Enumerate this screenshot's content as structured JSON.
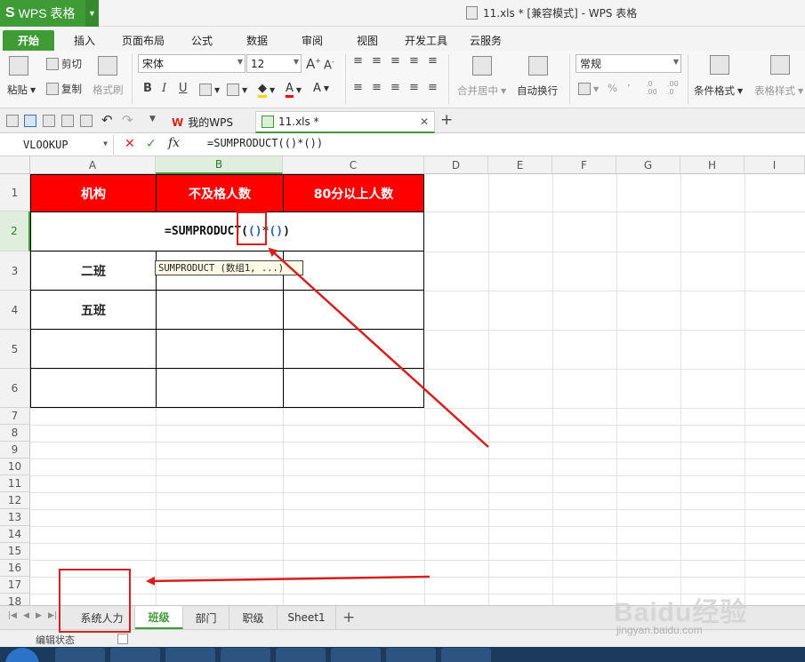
{
  "app": {
    "button_label": "WPS 表格",
    "window_title": "11.xls * [兼容模式] - WPS 表格"
  },
  "ribbon_tabs": [
    "开始",
    "插入",
    "页面布局",
    "公式",
    "数据",
    "审阅",
    "视图",
    "开发工具",
    "云服务"
  ],
  "ribbon": {
    "paste": "粘贴",
    "cut": "剪切",
    "copy": "复制",
    "format_painter": "格式刷",
    "font_name": "宋体",
    "font_size": "12",
    "bold": "B",
    "italic": "I",
    "underline": "U",
    "merge_center": "合并居中",
    "wrap_text": "自动换行",
    "number_format": "常规",
    "conditional_format": "条件格式",
    "table_style": "表格样式",
    "percent": "%",
    "comma": "٬",
    "increase_decimal": ".0 .00",
    "decrease_decimal": ".00 .0"
  },
  "doc_tabs": {
    "my_wps": "我的WPS",
    "file": "11.xls *",
    "add": "+"
  },
  "formula_bar": {
    "name_box": "VLOOKUP",
    "cancel": "✕",
    "confirm": "✓",
    "fx": "fx",
    "formula": "=SUMPRODUCT(()*())"
  },
  "columns": [
    "A",
    "B",
    "C",
    "D",
    "E",
    "F",
    "G",
    "H",
    "I"
  ],
  "rows": [
    "1",
    "2",
    "3",
    "4",
    "5",
    "6",
    "7",
    "8",
    "9",
    "10",
    "11",
    "12",
    "13",
    "14",
    "15",
    "16",
    "17",
    "18"
  ],
  "cells": {
    "A1": "机构",
    "B1": "不及格人数",
    "C1": "80分以上人数",
    "A3": "二班",
    "A4": "五班"
  },
  "editing": {
    "prefix": "=SUMPRODUCT",
    "p1": "(",
    "inner": "()",
    "star": "*",
    "p2": "()",
    "p3": ")"
  },
  "tooltip": "SUMPRODUCT (数组1, ...)",
  "sheet_tabs": [
    "系统人力",
    "班级",
    "部门",
    "职级",
    "Sheet1"
  ],
  "add_sheet": "+",
  "status": "编辑状态",
  "watermark": {
    "brand": "Baidu经验",
    "url": "jingyan.baidu.com"
  },
  "colors": {
    "accent": "#3f9b36",
    "header_fill": "#ff0000",
    "annotation": "#d61f1f"
  }
}
